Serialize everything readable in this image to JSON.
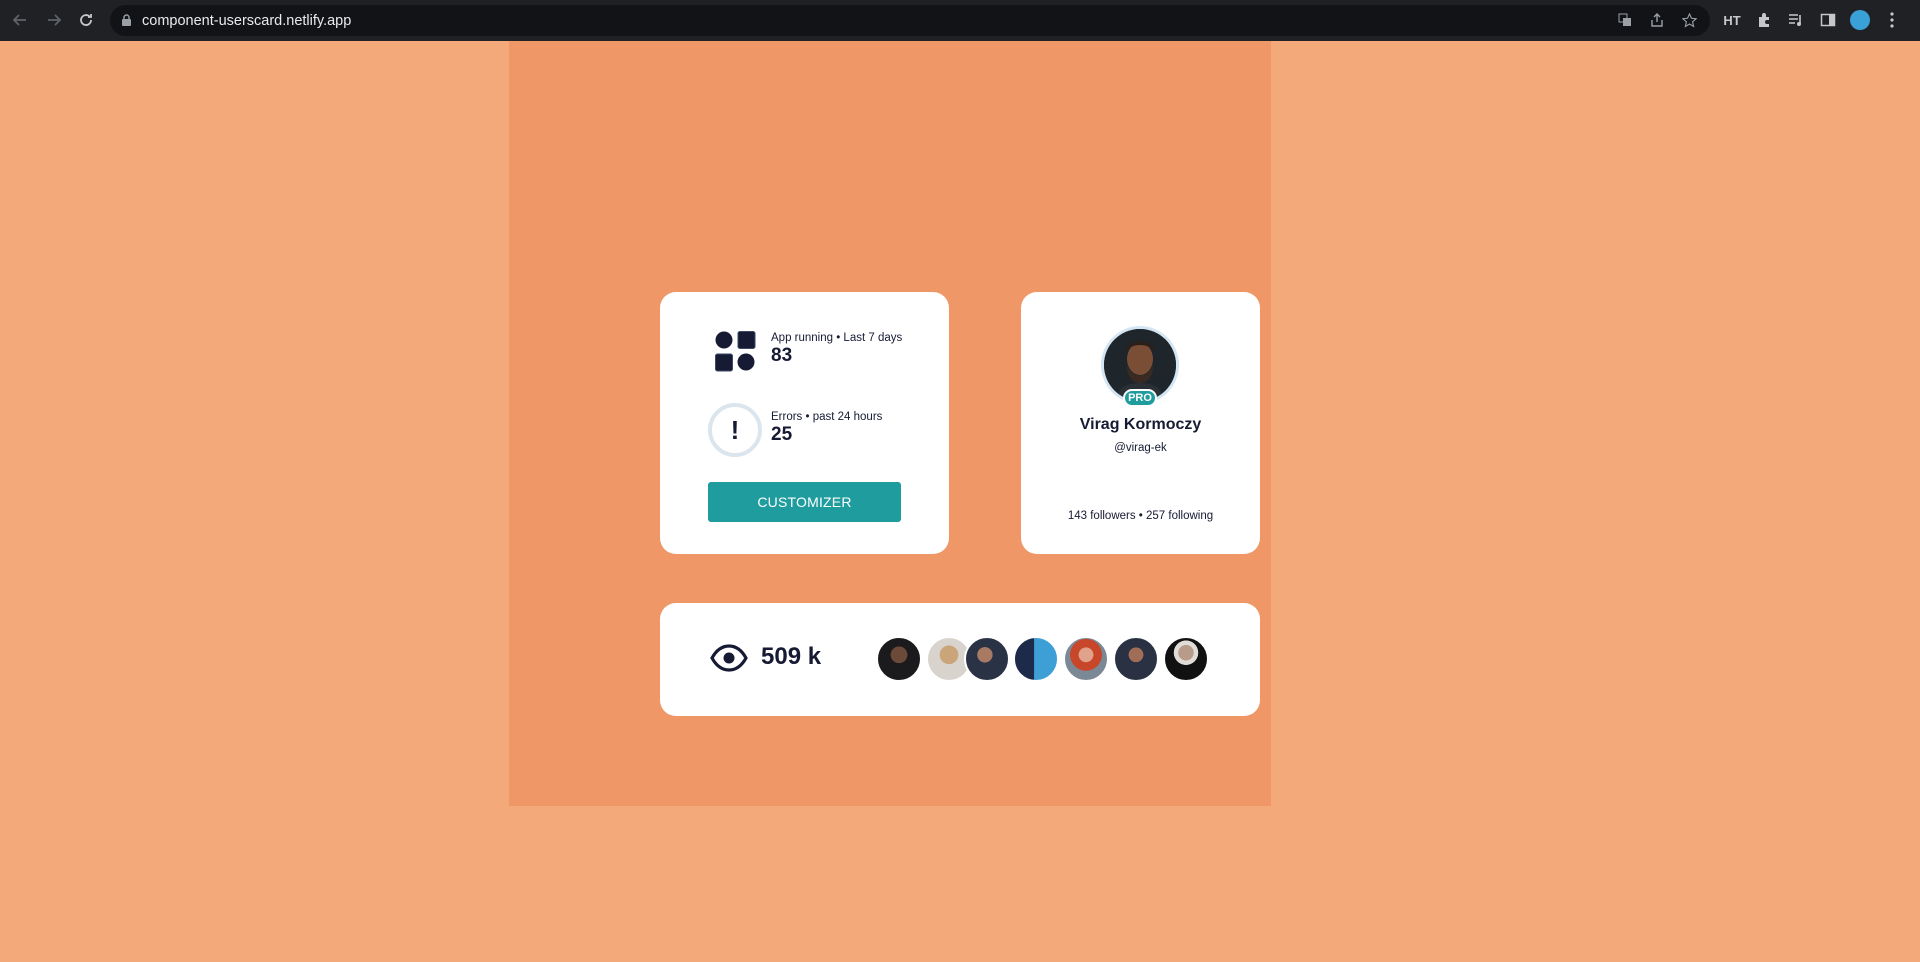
{
  "browser": {
    "url": "component-userscard.netlify.app",
    "nav": {
      "back_icon": "back-arrow-icon",
      "forward_icon": "forward-arrow-icon",
      "reload_icon": "reload-icon"
    },
    "extensions": {
      "ht_label": "HT"
    }
  },
  "stats_card": {
    "app_running_label": "App running • Last 7 days",
    "app_running_value": "83",
    "errors_label": "Errors • past 24 hours",
    "errors_value": "25",
    "error_glyph": "!",
    "customize_label": "CUSTOMIZER"
  },
  "profile_card": {
    "badge": "PRO",
    "name": "Virag Kormoczy",
    "handle": "@virag-ek",
    "follow_text": "143 followers • 257 following"
  },
  "views_card": {
    "views_value": "509 k",
    "viewers": [
      {
        "name": "viewer-1"
      },
      {
        "name": "viewer-2"
      },
      {
        "name": "viewer-3"
      },
      {
        "name": "viewer-4"
      },
      {
        "name": "viewer-5"
      },
      {
        "name": "viewer-6"
      },
      {
        "name": "viewer-7"
      }
    ]
  },
  "colors": {
    "background": "#f3a979",
    "stage": "#ef9767",
    "accent": "#1e9c9e",
    "text": "#161a33"
  }
}
